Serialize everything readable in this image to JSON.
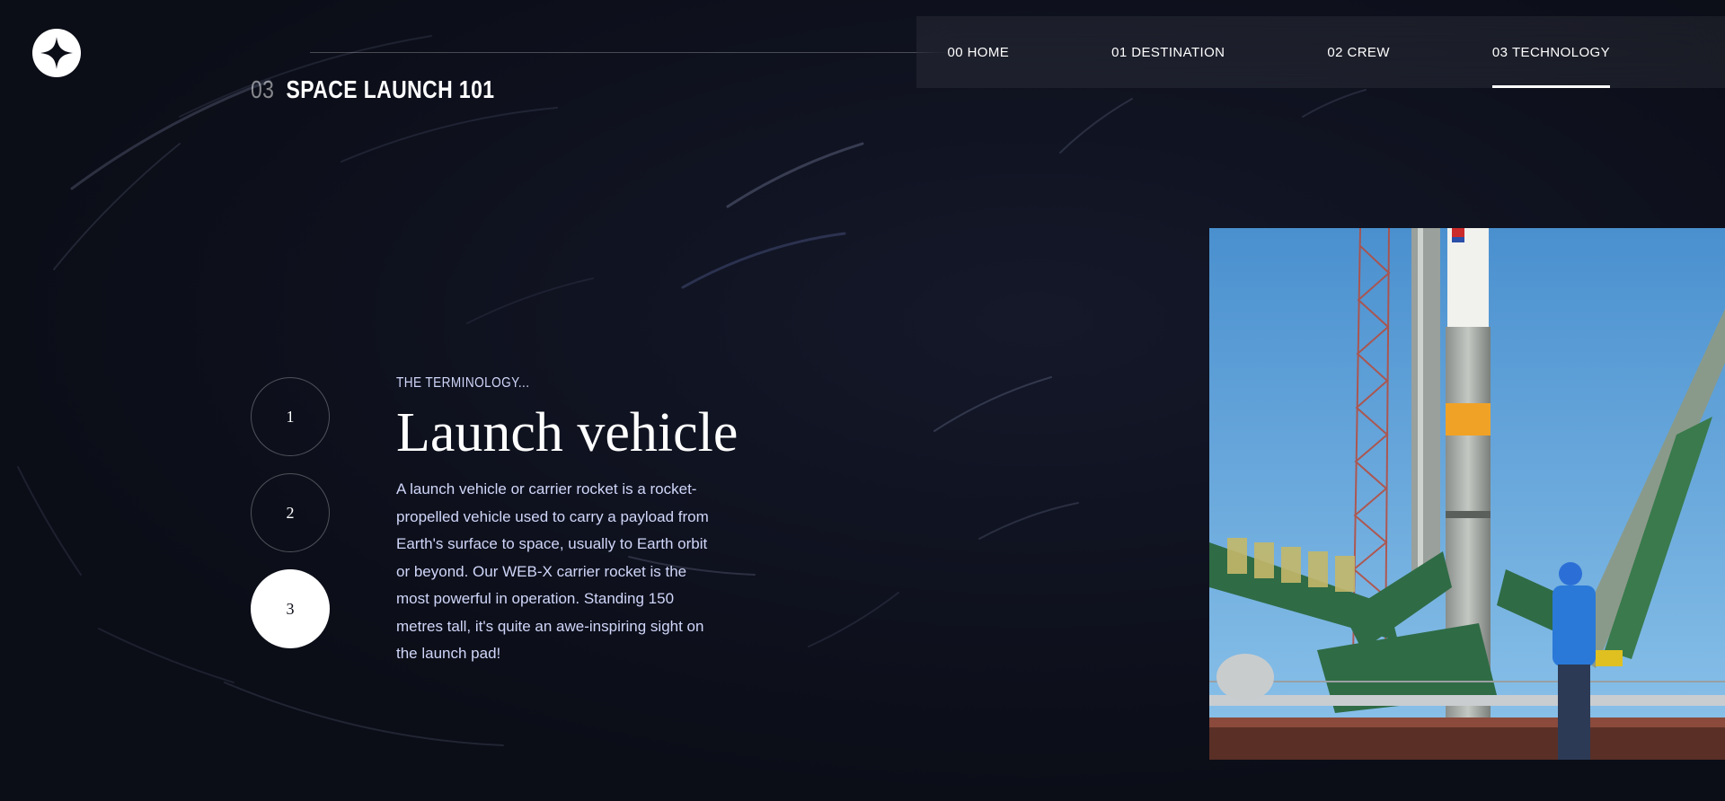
{
  "header": {
    "logo_icon": "four-point-star-icon"
  },
  "nav": {
    "items": [
      {
        "num": "00",
        "label": "HOME",
        "active": false
      },
      {
        "num": "01",
        "label": "DESTINATION",
        "active": false
      },
      {
        "num": "02",
        "label": "CREW",
        "active": false
      },
      {
        "num": "03",
        "label": "TECHNOLOGY",
        "active": true
      }
    ]
  },
  "page": {
    "heading_num": "03",
    "heading_text": "SPACE LAUNCH 101"
  },
  "pager": {
    "buttons": [
      "1",
      "2",
      "3"
    ],
    "active": "3"
  },
  "technology": {
    "eyebrow": "THE TERMINOLOGY...",
    "name": "Launch vehicle",
    "description": "A launch vehicle or carrier rocket is a rocket-propelled vehicle used to carry a payload from Earth's surface to space, usually to Earth orbit or beyond. Our WEB-X carrier rocket is the most powerful in operation. Standing 150 metres tall, it's quite an awe-inspiring sight on the launch pad!"
  },
  "colors": {
    "background": "#0b0d17",
    "text_secondary": "#d0d6f9",
    "sky": "#5fa3dc"
  }
}
